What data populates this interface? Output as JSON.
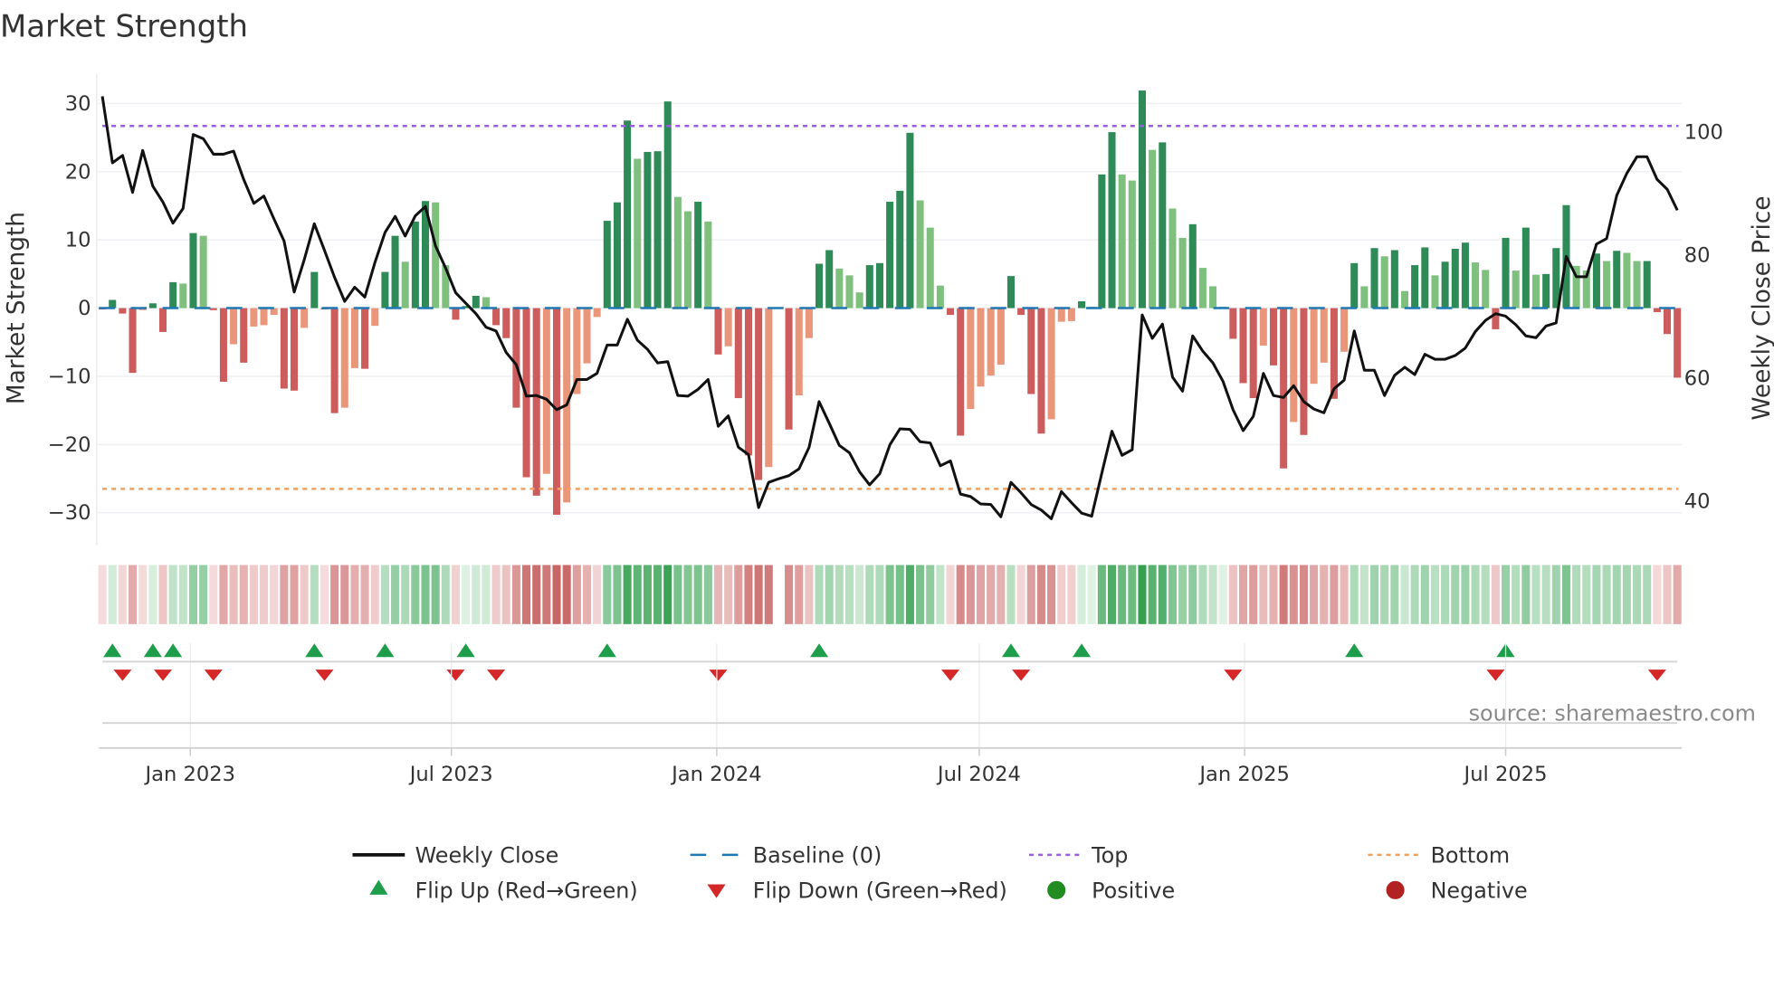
{
  "title": "Market Strength",
  "source": "source: sharemaestro.com",
  "colors": {
    "bar_up_strong": "#2e8b57",
    "bar_up_weak": "#7fc07f",
    "bar_down_strong": "#cd5c5c",
    "bar_down_weak": "#e9967a",
    "close_line": "#111111",
    "baseline": "#1f77b4",
    "top": "#9b5de5",
    "bottom": "#f0a060",
    "flip_up": "#1e9e4a",
    "flip_down": "#d62728",
    "positive": "#228b22",
    "negative": "#b22222",
    "grid": "#eef0f4"
  },
  "chart_data": {
    "type": "bar+line",
    "frequency": "weekly",
    "start_date": "2022-11-01",
    "strength": [
      -0.2,
      1.2,
      -0.8,
      -9.5,
      -0.3,
      0.7,
      -3.5,
      3.8,
      3.6,
      11,
      10.6,
      -0.3,
      -10.8,
      -5.3,
      -8,
      -2.7,
      -2.5,
      -1,
      -11.8,
      -12.1,
      -2.9,
      5.3,
      -0.2,
      -15.4,
      -14.6,
      -8.8,
      -8.9,
      -2.6,
      5.3,
      10.6,
      6.8,
      12.7,
      15.7,
      15.5,
      6.3,
      -1.7,
      0.3,
      1.8,
      1.6,
      -2.5,
      -4.4,
      -14.6,
      -24.8,
      -27.5,
      -24.3,
      -30.3,
      -28.5,
      -12.6,
      -8.1,
      -1.3,
      12.8,
      15.5,
      27.5,
      21.9,
      22.9,
      23,
      30.3,
      16.3,
      14.2,
      15.6,
      12.7,
      -6.8,
      -5.6,
      -13.2,
      -21.6,
      -25.2,
      -23.3,
      0,
      -17.8,
      -12.8,
      -4.4,
      6.5,
      8.5,
      5.8,
      4.8,
      2.3,
      6.3,
      6.6,
      15.6,
      17.2,
      25.7,
      15.8,
      11.8,
      3.3,
      -1,
      -18.7,
      -14.8,
      -11.5,
      -9.9,
      -8.3,
      4.7,
      -1,
      -12.6,
      -18.4,
      -16.3,
      -2,
      -1.9,
      1,
      0.2,
      19.6,
      25.8,
      19.6,
      18.7,
      31.9,
      23.2,
      24.3,
      14.6,
      10.3,
      12.3,
      5.9,
      3.2,
      0.2,
      -4.5,
      -11,
      -13.2,
      -5.5,
      -8.4,
      -23.5,
      -16.7,
      -18.6,
      -11.1,
      -8,
      -13.3,
      -6.4,
      6.6,
      3.2,
      8.8,
      7.6,
      8.5,
      2.5,
      6.3,
      8.9,
      4.8,
      6.8,
      8.7,
      9.6,
      6.7,
      5.6,
      -3.1,
      10.3,
      5.5,
      11.8,
      4.9,
      5,
      8.8,
      15.1,
      6.2,
      5.5,
      8,
      6.9,
      8.4,
      8.1,
      6.9,
      6.9,
      -0.6,
      -3.8,
      -10.2
    ],
    "close": [
      105.6,
      94.8,
      96.0,
      90.0,
      96.8,
      91.0,
      88.4,
      85.0,
      87.4,
      99.4,
      98.7,
      96.2,
      96.2,
      96.7,
      92.1,
      88.2,
      89.4,
      85.7,
      82.1,
      73.8,
      79.1,
      84.9,
      80.6,
      76.2,
      72.3,
      74.6,
      73.0,
      78.6,
      83.5,
      86.1,
      82.9,
      86.2,
      87.7,
      81.3,
      77.7,
      73.7,
      72.0,
      70.3,
      68.1,
      67.5,
      64.0,
      62.0,
      56.9,
      57.0,
      56.4,
      54.7,
      55.5,
      59.6,
      59.6,
      60.6,
      65.2,
      65.2,
      69.4,
      66.0,
      64.5,
      62.3,
      62.5,
      57.0,
      56.9,
      58.0,
      59.6,
      52.0,
      53.7,
      48.6,
      47.4,
      38.8,
      42.9,
      43.5,
      44.0,
      45.1,
      48.6,
      56.0,
      52.5,
      48.9,
      47.7,
      44.6,
      42.5,
      44.3,
      49.0,
      51.6,
      51.5,
      49.5,
      49.3,
      45.6,
      46.4,
      41.0,
      40.6,
      39.4,
      39.3,
      37.3,
      42.9,
      41.2,
      39.3,
      38.4,
      37.0,
      41.4,
      39.6,
      37.9,
      37.4,
      44.4,
      51.2,
      47.3,
      48.2,
      70.1,
      66.3,
      68.6,
      60.0,
      57.7,
      66.7,
      64.2,
      62.3,
      59.3,
      54.7,
      51.3,
      53.6,
      60.6,
      57.0,
      56.7,
      58.6,
      56.0,
      54.8,
      54.2,
      58.1,
      59.5,
      67.5,
      61.1,
      61.1,
      57.0,
      60.3,
      61.6,
      60.4,
      63.7,
      62.9,
      62.9,
      63.5,
      64.7,
      67.4,
      69.2,
      70.3,
      69.9,
      68.5,
      66.7,
      66.4,
      68.3,
      68.8,
      79.6,
      76.3,
      76.3,
      81.6,
      82.5,
      89.5,
      93.1,
      95.8,
      95.8,
      92.1,
      90.5,
      87.1
    ],
    "top_level": 26.7,
    "bottom_level": -26.5,
    "baseline": 0,
    "y_left": {
      "label": "Market Strength",
      "ticks": [
        30,
        20,
        10,
        0,
        -10,
        -20,
        -30
      ],
      "tick_labels": [
        "30",
        "20",
        "10",
        "0",
        "−10",
        "−20",
        "−30"
      ]
    },
    "y_right": {
      "label": "Weekly Close Price",
      "ticks": [
        100,
        80,
        60,
        40
      ],
      "tick_labels": [
        "100",
        "80",
        "60",
        "40"
      ]
    },
    "x_ticks": [
      {
        "label": "Jan 2023",
        "date": "2023-01-01"
      },
      {
        "label": "Jul 2023",
        "date": "2023-07-01"
      },
      {
        "label": "Jan 2024",
        "date": "2024-01-01"
      },
      {
        "label": "Jul 2024",
        "date": "2024-07-01"
      },
      {
        "label": "Jan 2025",
        "date": "2025-01-01"
      },
      {
        "label": "Jul 2025",
        "date": "2025-07-01"
      }
    ],
    "legend": [
      {
        "label": "Weekly Close",
        "key": "line"
      },
      {
        "label": "Baseline (0)",
        "key": "dash"
      },
      {
        "label": "Top",
        "key": "dot-top"
      },
      {
        "label": "Bottom",
        "key": "dot-bottom"
      },
      {
        "label": "Flip Up (Red→Green)",
        "key": "tri-up"
      },
      {
        "label": "Flip Down (Green→Red)",
        "key": "tri-down"
      },
      {
        "label": "Positive",
        "key": "circle-pos"
      },
      {
        "label": "Negative",
        "key": "circle-neg"
      }
    ]
  }
}
